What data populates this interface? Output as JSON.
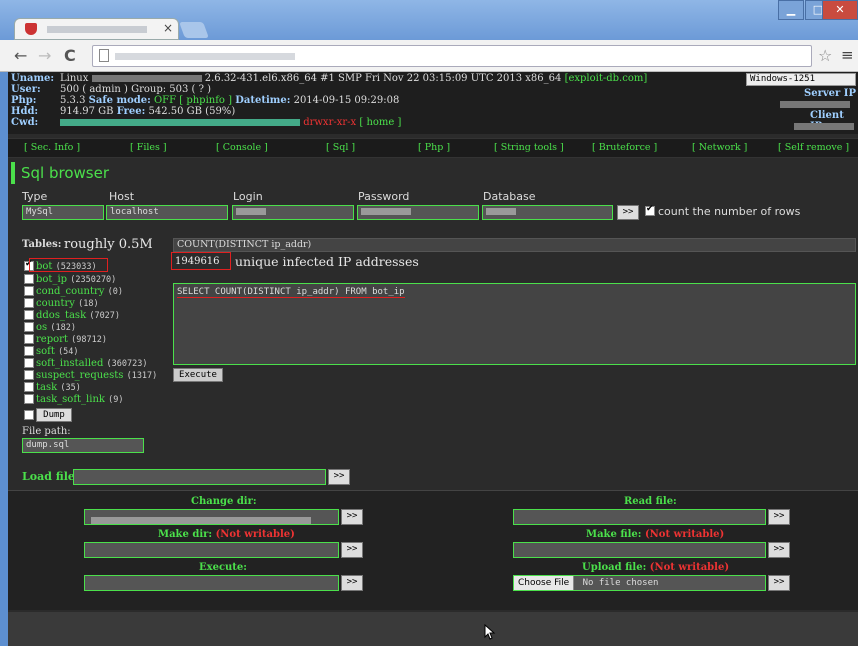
{
  "browser": {
    "tab_close": "×",
    "window_buttons": [
      "▁",
      "□",
      "✕"
    ],
    "nav": {
      "back": "←",
      "forward": "→",
      "reload": "C"
    },
    "star": "☆",
    "menu": "≡"
  },
  "info": {
    "uname_label": "Uname:",
    "uname_os": "Linux",
    "uname_rest": "2.6.32-431.el6.x86_64 #1 SMP Fri Nov 22 03:15:09 UTC 2013 x86_64",
    "exploit_link": "[exploit-db.com]",
    "user_label": "User:",
    "user_value": "500 ( admin ) Group: 503 ( ? )",
    "php_label": "Php:",
    "php_version": "5.3.3",
    "safe_mode_label": "Safe mode:",
    "safe_mode_value": "OFF",
    "phpinfo_link": "[ phpinfo ]",
    "datetime_label": "Datetime:",
    "datetime_value": "2014-09-15 09:29:08",
    "hdd_label": "Hdd:",
    "hdd_value": "914.97 GB",
    "free_label": "Free:",
    "free_value": "542.50 GB (59%)",
    "cwd_label": "Cwd:",
    "cwd_perm": "drwxr-xr-x",
    "home_link": "[ home ]",
    "encoding": "Windows-1251",
    "server_ip_label": "Server IP",
    "client_ip_label": "Client IP"
  },
  "nav": [
    "[ Sec. Info ]",
    "[ Files ]",
    "[ Console ]",
    "[ Sql ]",
    "[ Php ]",
    "[ String tools ]",
    "[ Bruteforce ]",
    "[ Network ]",
    "[ Self remove ]"
  ],
  "section_title": "Sql browser",
  "form": {
    "type_label": "Type",
    "type_value": "MySql",
    "host_label": "Host",
    "host_value": "localhost",
    "login_label": "Login",
    "password_label": "Password",
    "database_label": "Database",
    "go_button": ">>",
    "count_rows_label": "count the number of rows"
  },
  "tables_label": "Tables:",
  "annotation_rows": "roughly 0.5M",
  "tables": [
    {
      "name": "bot",
      "count": "(523033)"
    },
    {
      "name": "bot_ip",
      "count": "(2350270)"
    },
    {
      "name": "cond_country",
      "count": "(0)"
    },
    {
      "name": "country",
      "count": "(18)"
    },
    {
      "name": "ddos_task",
      "count": "(7027)"
    },
    {
      "name": "os",
      "count": "(182)"
    },
    {
      "name": "report",
      "count": "(98712)"
    },
    {
      "name": "soft",
      "count": "(54)"
    },
    {
      "name": "soft_installed",
      "count": "(360723)"
    },
    {
      "name": "suspect_requests",
      "count": "(1317)"
    },
    {
      "name": "task",
      "count": "(35)"
    },
    {
      "name": "task_soft_link",
      "count": "(9)"
    }
  ],
  "dump_button": "Dump",
  "file_path_label": "File path:",
  "file_path_value": "dump.sql",
  "result": {
    "column": "COUNT(DISTINCT ip_addr)",
    "value": "1949616",
    "annotation": "unique infected IP addresses"
  },
  "sql_query": "SELECT COUNT(DISTINCT ip_addr) FROM bot_ip",
  "execute_button": "Execute",
  "load_file_label": "Load file",
  "bottom": {
    "change_dir": "Change dir:",
    "read_file": "Read file:",
    "make_dir": "Make dir:",
    "make_file": "Make file:",
    "not_writable": "(Not writable)",
    "execute": "Execute:",
    "upload_file": "Upload file:",
    "choose_file": "Choose File",
    "no_file": "No file chosen",
    "go": ">>"
  }
}
